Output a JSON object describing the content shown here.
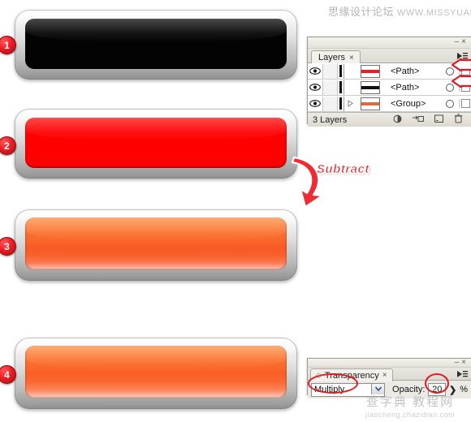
{
  "watermarks": {
    "top_cn": "思缘设计论坛",
    "top_url": "WWW.MISSYUAN.COM",
    "bottom_cn": "查字典 教程网",
    "bottom_url": "jiaocheng.chazidian.com"
  },
  "steps": [
    {
      "badge": "1",
      "name": "black-button",
      "fill": "#030303",
      "description": "black rounded button"
    },
    {
      "badge": "2",
      "name": "red-button",
      "fill": "#ff0000",
      "description": "red rounded button"
    },
    {
      "badge": "3",
      "name": "orange-gradient-button",
      "fill": "#f85a25",
      "description": "orange gradient rounded button"
    },
    {
      "badge": "4",
      "name": "orange-multiply-button",
      "fill": "#f95f26",
      "description": "orange button with multiply blend"
    }
  ],
  "annotation": {
    "subtract_label": "Subtract",
    "accent_color": "#e8262f"
  },
  "layers_panel": {
    "tab_label": "Layers",
    "tab_close": "×",
    "minimize": "–",
    "close": "×",
    "rows": [
      {
        "name": "<Path>",
        "thumb_color": "#ee1c25",
        "has_disclosure": false,
        "visible": true,
        "locked": false
      },
      {
        "name": "<Path>",
        "thumb_color": "#101010",
        "has_disclosure": false,
        "visible": true,
        "locked": false
      },
      {
        "name": "<Group>",
        "thumb_color": "#e06a3c",
        "has_disclosure": true,
        "visible": true,
        "locked": false
      }
    ],
    "footer_count": "3 Layers",
    "footer_icons": [
      "make-clipping-mask-icon",
      "create-new-sublayer-icon",
      "create-new-layer-icon",
      "delete-selection-icon"
    ],
    "arrow_rows": [
      0,
      1
    ]
  },
  "transparency_panel": {
    "tab_label": "Transparency",
    "tab_close": "×",
    "minimize": "–",
    "close": "×",
    "blend_mode": "Multiply",
    "opacity_label": "Opacity:",
    "opacity_value": "20",
    "percent": "%",
    "stepper_arrow": "❯",
    "highlight_color": "#e11b22"
  }
}
